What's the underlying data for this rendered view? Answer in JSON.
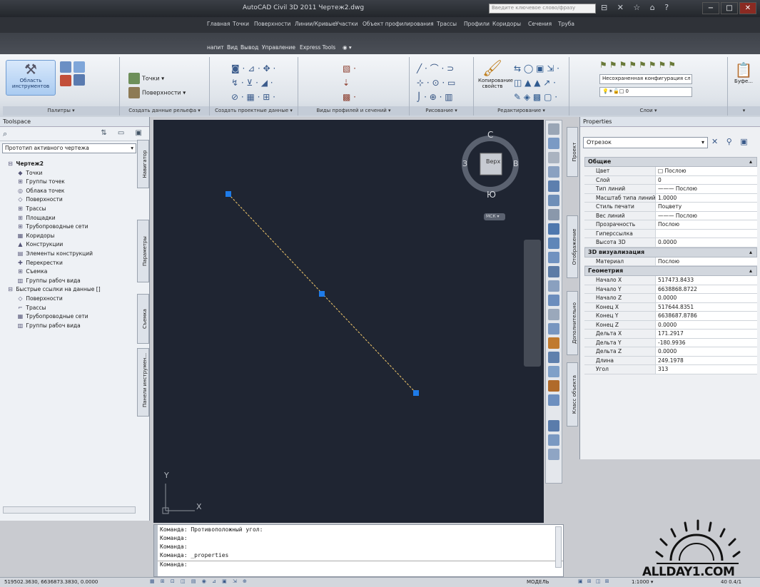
{
  "window": {
    "title": "AutoCAD Civil 3D 2011   Чертеж2.dwg",
    "search_placeholder": "Введите ключевое слово/фразу",
    "buttons": [
      "−",
      "□",
      "✕"
    ]
  },
  "ribbon_tabs_top": [
    "Главная",
    "Точки",
    "Поверхности",
    "Линии/Кривые",
    "Участки",
    "Объект профилирования",
    "Трассы",
    "Профили",
    "Коридоры",
    "Сечения",
    "Труба"
  ],
  "ribbon_tabs": [
    "напит",
    "Вид",
    "Вывод",
    "Управление",
    "Express Tools"
  ],
  "ribbon": {
    "panels": [
      {
        "title": "Палитры ▾",
        "big_button": "Область инструментов"
      },
      {
        "title": "Создать данные рельефа ▾",
        "items": [
          "Точки ▾",
          "Поверхности ▾"
        ]
      },
      {
        "title": "Создать проектные данные ▾"
      },
      {
        "title": "Виды профилей и сечений ▾"
      },
      {
        "title": "Рисование ▾"
      },
      {
        "title": "Редактирование ▾",
        "big_button": "Копирование свойств"
      },
      {
        "title": "Слои ▾",
        "layer_state": "Несохраненная конфигурация сл ▾",
        "layer_name": "0"
      },
      {
        "title": "▾",
        "big_button": "Буфе..."
      }
    ]
  },
  "toolspace": {
    "title": "Toolspace",
    "dropdown": "Прототип активного чертежа",
    "tree": [
      {
        "label": "Чертеж2",
        "level": 0,
        "bold": true,
        "glyph": "⊟"
      },
      {
        "label": "Точки",
        "level": 1,
        "glyph": "◆"
      },
      {
        "label": "Группы точек",
        "level": 1,
        "glyph": "⊞"
      },
      {
        "label": "Облака точек",
        "level": 1,
        "glyph": "◎"
      },
      {
        "label": "Поверхности",
        "level": 1,
        "glyph": "◇"
      },
      {
        "label": "Трассы",
        "level": 1,
        "glyph": "⊞"
      },
      {
        "label": "Площадки",
        "level": 1,
        "glyph": "⊞"
      },
      {
        "label": "Трубопроводные сети",
        "level": 1,
        "glyph": "⊞"
      },
      {
        "label": "Коридоры",
        "level": 1,
        "glyph": "▦"
      },
      {
        "label": "Конструкции",
        "level": 1,
        "glyph": "▲"
      },
      {
        "label": "Элементы конструкций",
        "level": 1,
        "glyph": "▤"
      },
      {
        "label": "Перекрестки",
        "level": 1,
        "glyph": "✚"
      },
      {
        "label": "Съемка",
        "level": 1,
        "glyph": "⊞"
      },
      {
        "label": "Группы рабоч вида",
        "level": 1,
        "glyph": "▥"
      },
      {
        "label": "Быстрые ссылки на данные []",
        "level": 0,
        "glyph": "⊟"
      },
      {
        "label": "Поверхности",
        "level": 1,
        "glyph": "◇"
      },
      {
        "label": "Трассы",
        "level": 1,
        "glyph": "⌐"
      },
      {
        "label": "Трубопроводные сети",
        "level": 1,
        "glyph": "▦"
      },
      {
        "label": "Группы рабоч вида",
        "level": 1,
        "glyph": "▥"
      }
    ],
    "side_tabs": [
      "Навигатор",
      "Параметры",
      "Съемка",
      "Панели инструмен..."
    ]
  },
  "viewcube": {
    "face": "Верх",
    "north": "С",
    "south": "Ю",
    "west": "З",
    "east": "В",
    "wcs": "МСК ▾"
  },
  "ucs": {
    "x_label": "X",
    "y_label": "Y"
  },
  "command_lines": [
    "Команда: Противоположный угол:",
    "Команда:",
    "Команда:",
    "Команда:  _properties",
    "Команда:"
  ],
  "status": {
    "coords": "519502.3630, 6636873.3830, 0.0000",
    "model": "МОДЕЛЬ",
    "scale": "1:1000 ▾",
    "right": "40  0.4/1"
  },
  "properties": {
    "title": "Properties",
    "object": "Отрезок",
    "right_tabs": [
      "Проект",
      "Отображение",
      "Дополнительно",
      "Класс объекта"
    ],
    "sections": [
      {
        "name": "Общие",
        "rows": [
          [
            "Цвет",
            "□ Послою"
          ],
          [
            "Слой",
            "0"
          ],
          [
            "Тип линий",
            "——— Послою"
          ],
          [
            "Масштаб типа линий",
            "1.0000"
          ],
          [
            "Стиль печати",
            "Поцвету"
          ],
          [
            "Вес линий",
            "——— Послою"
          ],
          [
            "Прозрачность",
            "Послою"
          ],
          [
            "Гиперссылка",
            ""
          ],
          [
            "Высота 3D",
            "0.0000"
          ]
        ]
      },
      {
        "name": "3D визуализация",
        "rows": [
          [
            "Материал",
            "Послою"
          ]
        ]
      },
      {
        "name": "Геометрия",
        "rows": [
          [
            "Начало X",
            "517473.8433"
          ],
          [
            "Начало Y",
            "6638868.8722"
          ],
          [
            "Начало Z",
            "0.0000"
          ],
          [
            "Конец X",
            "517644.8351"
          ],
          [
            "Конец Y",
            "6638687.8786"
          ],
          [
            "Конец Z",
            "0.0000"
          ],
          [
            "Дельта X",
            "171.2917"
          ],
          [
            "Дельта Y",
            "-180.9936"
          ],
          [
            "Дельта Z",
            "0.0000"
          ],
          [
            "Длина",
            "249.1978"
          ],
          [
            "Угол",
            "313"
          ]
        ]
      }
    ]
  },
  "watermark": "ALLDAY1.COM",
  "colors": {
    "canvas": "#1f2532",
    "grip": "#1e7be8",
    "line": "#f2c86a"
  }
}
